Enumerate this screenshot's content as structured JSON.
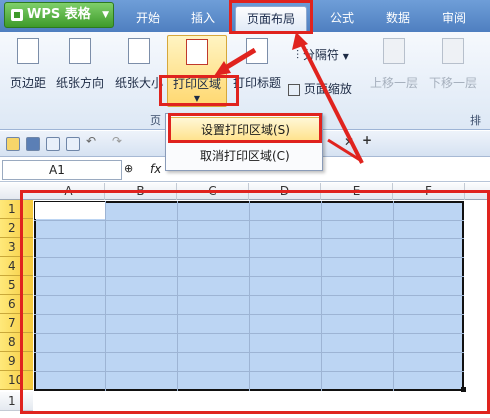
{
  "app": {
    "title": "WPS 表格"
  },
  "tabs": [
    {
      "label": "开始"
    },
    {
      "label": "插入"
    },
    {
      "label": "页面布局"
    },
    {
      "label": "公式"
    },
    {
      "label": "数据"
    },
    {
      "label": "审阅"
    }
  ],
  "ribbon": {
    "margins": "页边距",
    "orientation": "纸张方向",
    "size": "纸张大小",
    "print_area": "打印区域",
    "print_titles": "打印标题",
    "breaks": "分隔符",
    "scale": "页面缩放",
    "bring_forward": "上移一层",
    "send_backward": "下移一层",
    "group_page_label": "页",
    "group_arrange_label": "排"
  },
  "dropdown": {
    "set_print_area": "设置打印区域(S)",
    "clear_print_area": "取消打印区域(C)"
  },
  "formula_bar": {
    "name_box": "A1",
    "fx": "fx"
  },
  "grid": {
    "columns": [
      "A",
      "B",
      "C",
      "D",
      "E",
      "F"
    ],
    "rows": [
      "1",
      "2",
      "3",
      "4",
      "5",
      "6",
      "7",
      "8",
      "9",
      "10",
      "1"
    ]
  },
  "colors": {
    "annotation": "#e0231e",
    "selection": "#bcd5f3",
    "row_header_highlight": "#f5c93c"
  }
}
